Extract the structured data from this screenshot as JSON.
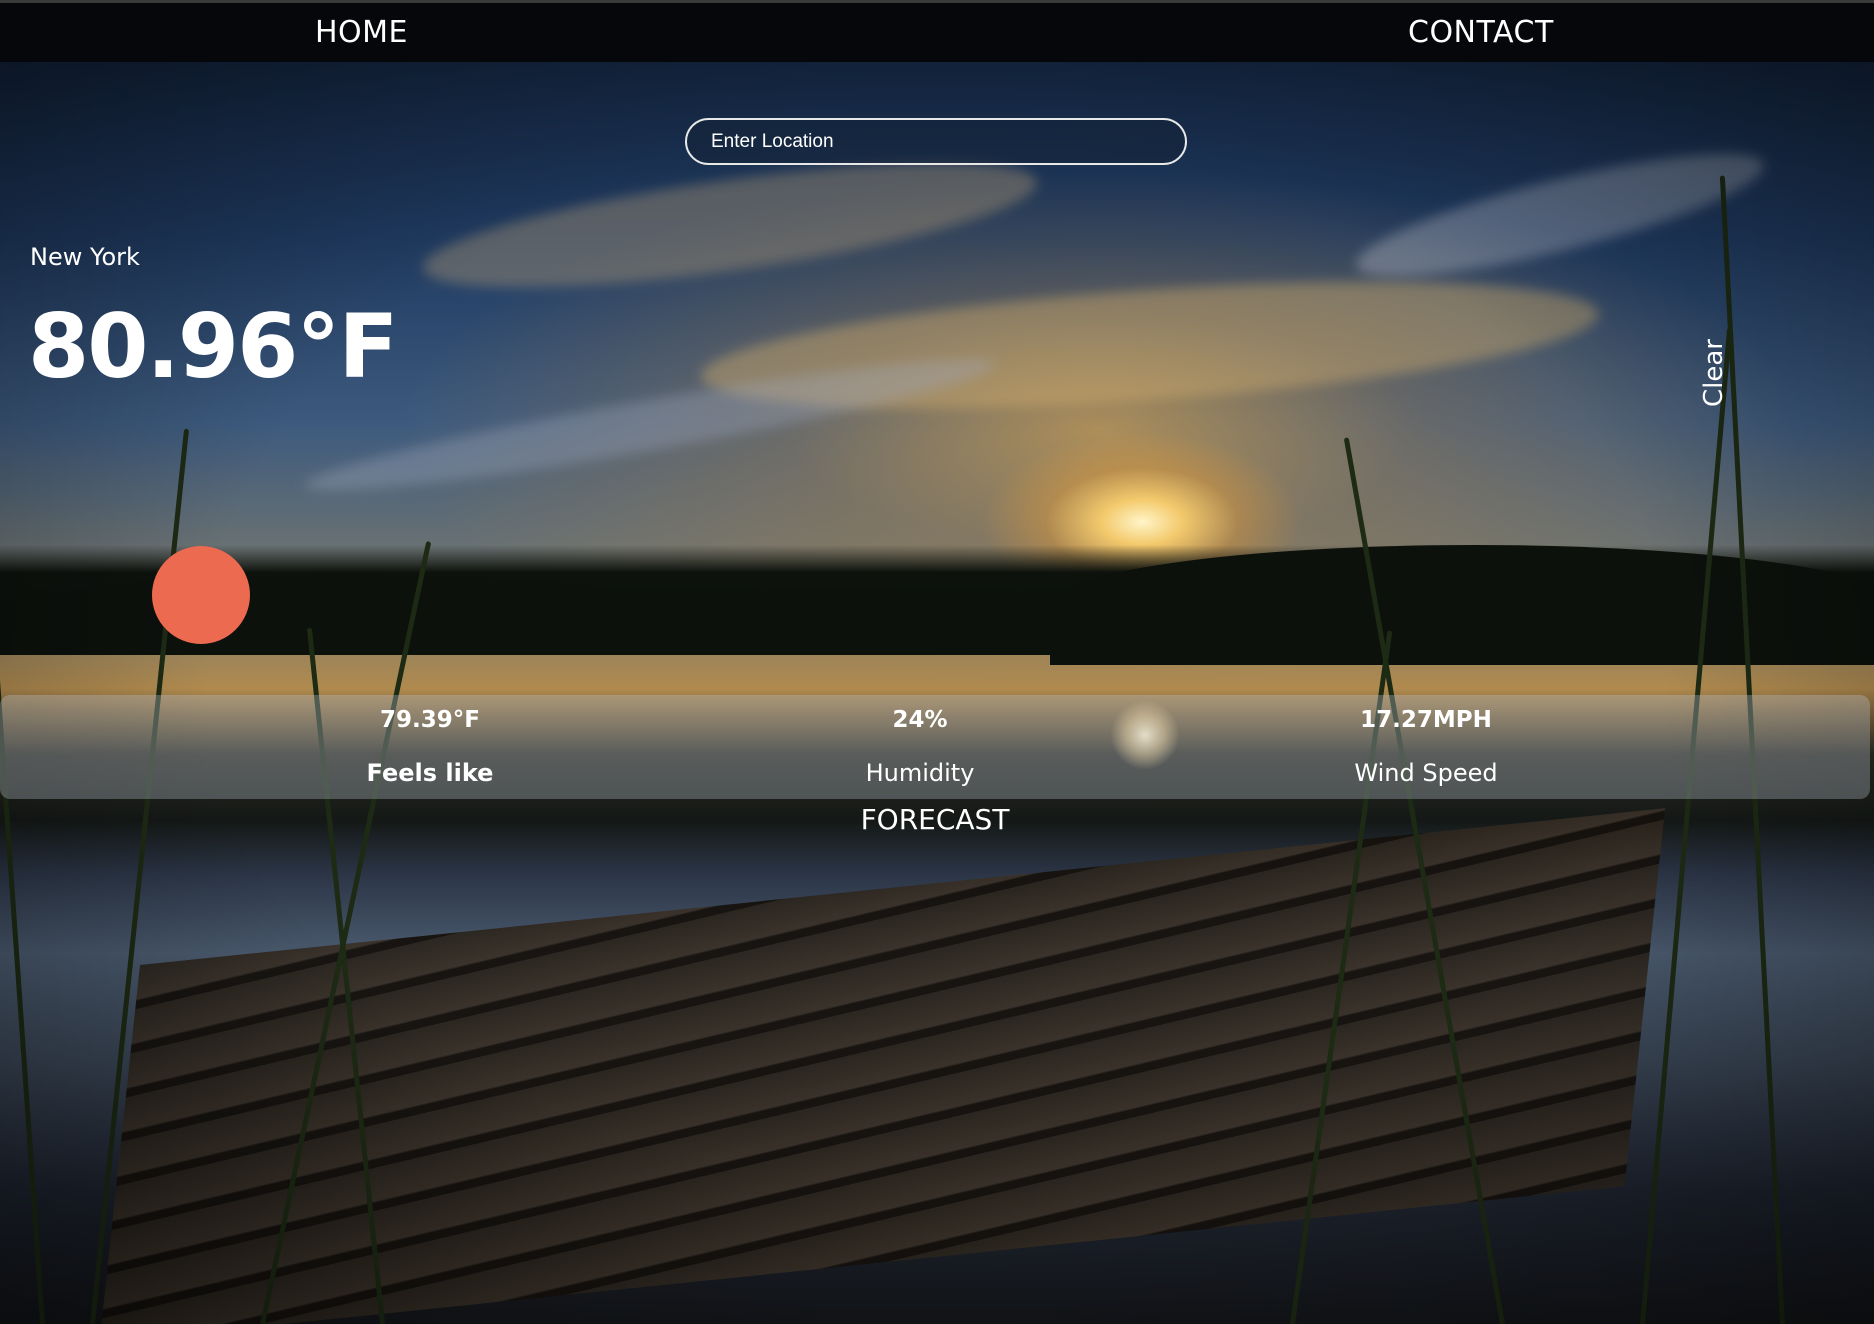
{
  "nav": {
    "home_label": "HOME",
    "contact_label": "CONTACT"
  },
  "search": {
    "placeholder": "Enter Location",
    "value": ""
  },
  "current": {
    "city": "New York",
    "temperature": "80.96°F",
    "condition": "Clear",
    "icon": "sun-icon",
    "icon_color": "#ec6a50"
  },
  "stats": {
    "feels_like": {
      "value": "79.39°F",
      "label": "Feels like"
    },
    "humidity": {
      "value": "24%",
      "label": "Humidity"
    },
    "wind_speed": {
      "value": "17.27MPH",
      "label": "Wind Speed"
    }
  },
  "forecast": {
    "heading": "FORECAST"
  },
  "background": {
    "description_icon": "sunset-lake-photo-icon"
  }
}
